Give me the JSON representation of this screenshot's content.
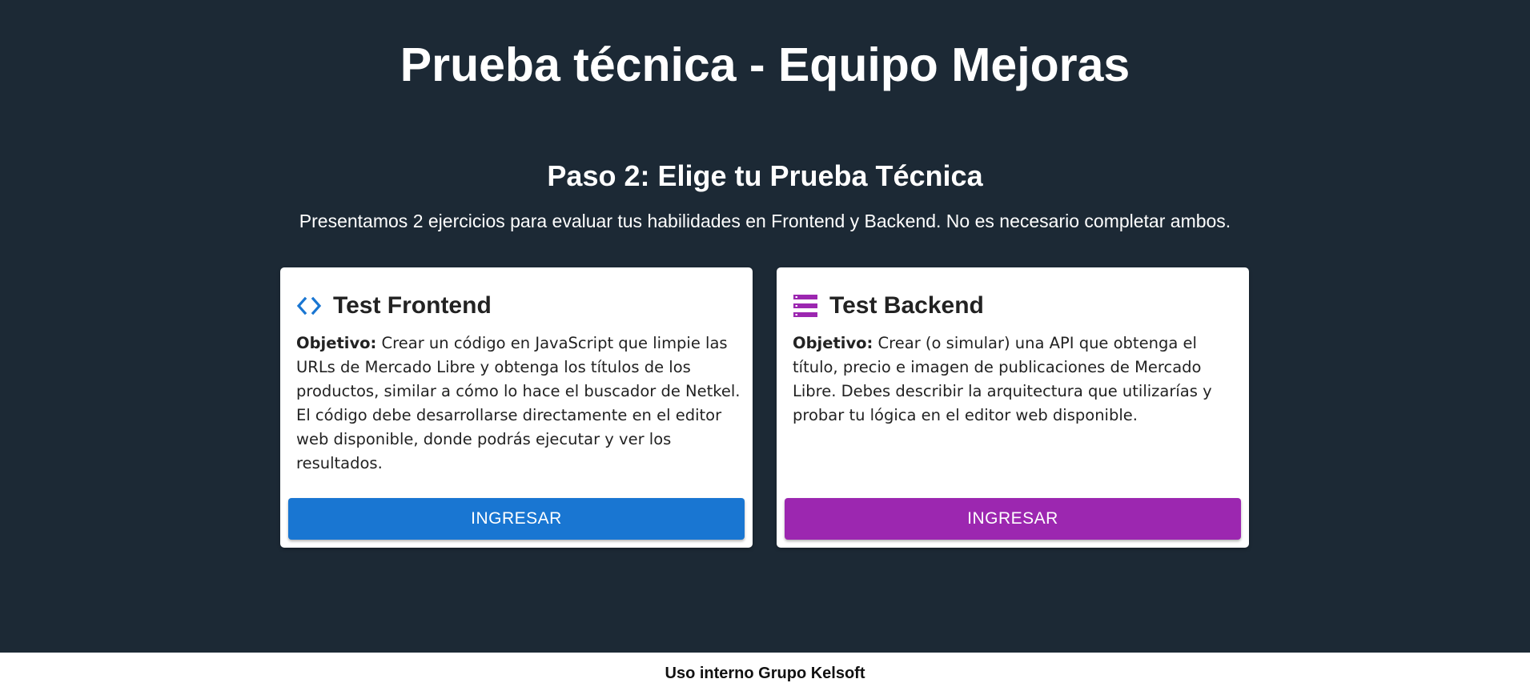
{
  "header": {
    "title": "Prueba técnica - Equipo Mejoras"
  },
  "step": {
    "title": "Paso 2: Elige tu Prueba Técnica",
    "description": "Presentamos 2 ejercicios para evaluar tus habilidades en Frontend y Backend. No es necesario completar ambos."
  },
  "cards": [
    {
      "icon": "code-icon",
      "title": "Test Frontend",
      "objective_label": "Objetivo:",
      "objective_text": " Crear un código en JavaScript que limpie las URLs de Mercado Libre y obtenga los títulos de los productos, similar a cómo lo hace el buscador de Netkel. El código debe desarrollarse directamente en el editor web disponible, donde podrás ejecutar y ver los resultados.",
      "button_label": "INGRESAR",
      "accent_color": "#1976d2"
    },
    {
      "icon": "storage-icon",
      "title": "Test Backend",
      "objective_label": "Objetivo:",
      "objective_text": " Crear (o simular) una API que obtenga el título, precio e imagen de publicaciones de Mercado Libre. Debes describir la arquitectura que utilizarías y probar tu lógica en el editor web disponible.",
      "button_label": "INGRESAR",
      "accent_color": "#9c27b0"
    }
  ],
  "footer": {
    "text": "Uso interno Grupo Kelsoft"
  },
  "colors": {
    "background": "#1c2935",
    "card": "#ffffff",
    "footer": "#ffffff"
  }
}
